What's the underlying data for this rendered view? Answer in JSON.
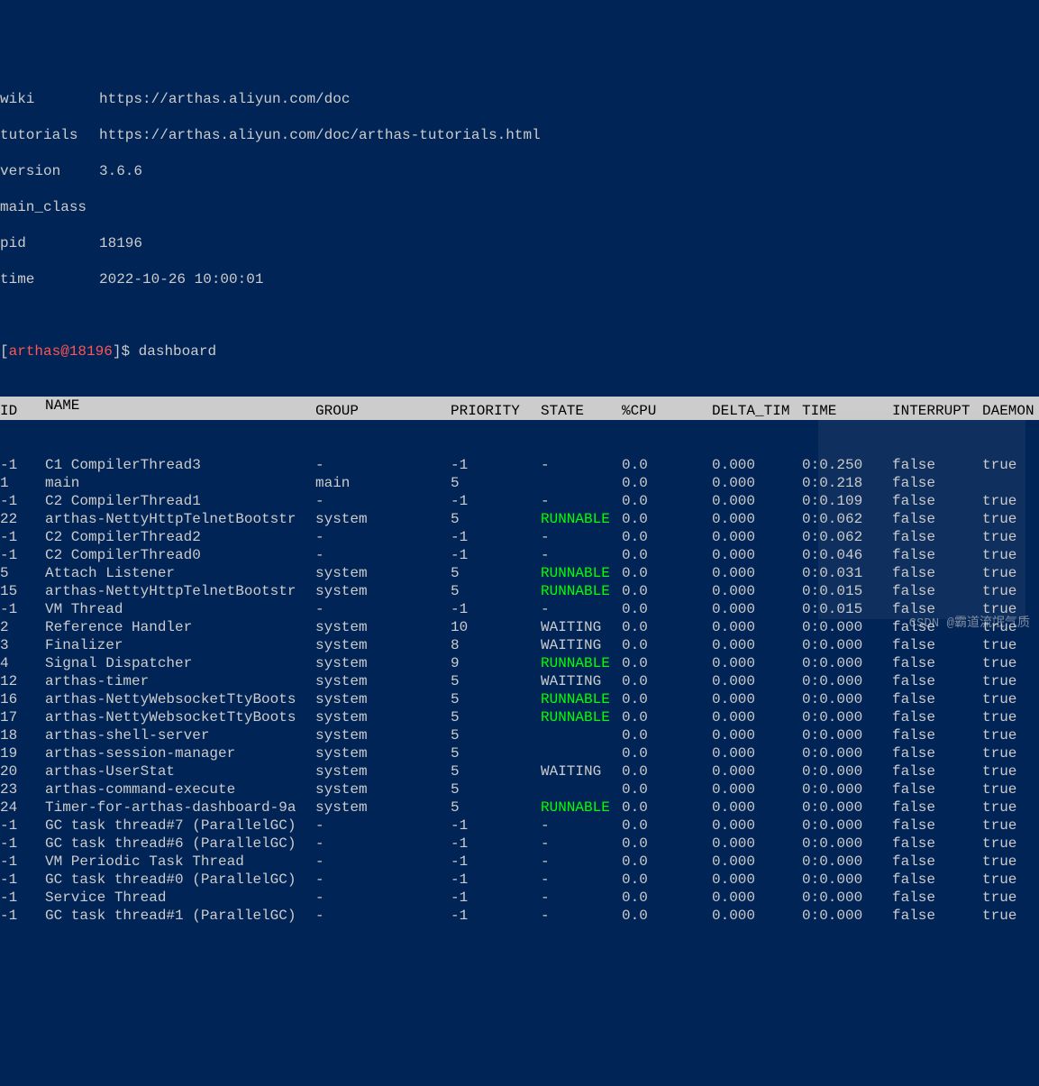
{
  "info": {
    "wiki_label": "wiki",
    "wiki_value": "https://arthas.aliyun.com/doc",
    "tutorials_label": "tutorials",
    "tutorials_value": "https://arthas.aliyun.com/doc/arthas-tutorials.html",
    "version_label": "version",
    "version_value": "3.6.6",
    "mainclass_label": "main_class",
    "mainclass_value": "",
    "pid_label": "pid",
    "pid_value": "18196",
    "time_label": "time",
    "time_value": "2022-10-26 10:00:01"
  },
  "prompt": {
    "open_bracket": "[",
    "text": "arthas@18196",
    "close_bracket": "]",
    "dollar": "$ ",
    "command": "dashboard"
  },
  "headers": {
    "id": "ID",
    "name": "NAME",
    "group": "GROUP",
    "priority": "PRIORITY",
    "state": "STATE",
    "cpu": "%CPU",
    "delta": "DELTA_TIM",
    "time": "TIME",
    "interrupt": "INTERRUPT",
    "daemon": "DAEMON"
  },
  "rows": [
    {
      "id": "-1",
      "name": "C1 CompilerThread3",
      "group": "-",
      "priority": "-1",
      "state": "-",
      "cpu": "0.0",
      "delta": "0.000",
      "time": "0:0.250",
      "interrupt": "false",
      "daemon": "true"
    },
    {
      "id": "1",
      "name": "main",
      "group": "main",
      "priority": "5",
      "state": "",
      "cpu": "0.0",
      "delta": "0.000",
      "time": "0:0.218",
      "interrupt": "false",
      "daemon": ""
    },
    {
      "id": "-1",
      "name": "C2 CompilerThread1",
      "group": "-",
      "priority": "-1",
      "state": "-",
      "cpu": "0.0",
      "delta": "0.000",
      "time": "0:0.109",
      "interrupt": "false",
      "daemon": "true"
    },
    {
      "id": "22",
      "name": "arthas-NettyHttpTelnetBootstr",
      "group": "system",
      "priority": "5",
      "state": "RUNNABLE",
      "cpu": "0.0",
      "delta": "0.000",
      "time": "0:0.062",
      "interrupt": "false",
      "daemon": "true"
    },
    {
      "id": "-1",
      "name": "C2 CompilerThread2",
      "group": "-",
      "priority": "-1",
      "state": "-",
      "cpu": "0.0",
      "delta": "0.000",
      "time": "0:0.062",
      "interrupt": "false",
      "daemon": "true"
    },
    {
      "id": "-1",
      "name": "C2 CompilerThread0",
      "group": "-",
      "priority": "-1",
      "state": "-",
      "cpu": "0.0",
      "delta": "0.000",
      "time": "0:0.046",
      "interrupt": "false",
      "daemon": "true"
    },
    {
      "id": "5",
      "name": "Attach Listener",
      "group": "system",
      "priority": "5",
      "state": "RUNNABLE",
      "cpu": "0.0",
      "delta": "0.000",
      "time": "0:0.031",
      "interrupt": "false",
      "daemon": "true"
    },
    {
      "id": "15",
      "name": "arthas-NettyHttpTelnetBootstr",
      "group": "system",
      "priority": "5",
      "state": "RUNNABLE",
      "cpu": "0.0",
      "delta": "0.000",
      "time": "0:0.015",
      "interrupt": "false",
      "daemon": "true"
    },
    {
      "id": "-1",
      "name": "VM Thread",
      "group": "-",
      "priority": "-1",
      "state": "-",
      "cpu": "0.0",
      "delta": "0.000",
      "time": "0:0.015",
      "interrupt": "false",
      "daemon": "true"
    },
    {
      "id": "2",
      "name": "Reference Handler",
      "group": "system",
      "priority": "10",
      "state": "WAITING",
      "cpu": "0.0",
      "delta": "0.000",
      "time": "0:0.000",
      "interrupt": "false",
      "daemon": "true"
    },
    {
      "id": "3",
      "name": "Finalizer",
      "group": "system",
      "priority": "8",
      "state": "WAITING",
      "cpu": "0.0",
      "delta": "0.000",
      "time": "0:0.000",
      "interrupt": "false",
      "daemon": "true"
    },
    {
      "id": "4",
      "name": "Signal Dispatcher",
      "group": "system",
      "priority": "9",
      "state": "RUNNABLE",
      "cpu": "0.0",
      "delta": "0.000",
      "time": "0:0.000",
      "interrupt": "false",
      "daemon": "true"
    },
    {
      "id": "12",
      "name": "arthas-timer",
      "group": "system",
      "priority": "5",
      "state": "WAITING",
      "cpu": "0.0",
      "delta": "0.000",
      "time": "0:0.000",
      "interrupt": "false",
      "daemon": "true"
    },
    {
      "id": "16",
      "name": "arthas-NettyWebsocketTtyBoots",
      "group": "system",
      "priority": "5",
      "state": "RUNNABLE",
      "cpu": "0.0",
      "delta": "0.000",
      "time": "0:0.000",
      "interrupt": "false",
      "daemon": "true"
    },
    {
      "id": "17",
      "name": "arthas-NettyWebsocketTtyBoots",
      "group": "system",
      "priority": "5",
      "state": "RUNNABLE",
      "cpu": "0.0",
      "delta": "0.000",
      "time": "0:0.000",
      "interrupt": "false",
      "daemon": "true"
    },
    {
      "id": "18",
      "name": "arthas-shell-server",
      "group": "system",
      "priority": "5",
      "state": "",
      "cpu": "0.0",
      "delta": "0.000",
      "time": "0:0.000",
      "interrupt": "false",
      "daemon": "true"
    },
    {
      "id": "19",
      "name": "arthas-session-manager",
      "group": "system",
      "priority": "5",
      "state": "",
      "cpu": "0.0",
      "delta": "0.000",
      "time": "0:0.000",
      "interrupt": "false",
      "daemon": "true"
    },
    {
      "id": "20",
      "name": "arthas-UserStat",
      "group": "system",
      "priority": "5",
      "state": "WAITING",
      "cpu": "0.0",
      "delta": "0.000",
      "time": "0:0.000",
      "interrupt": "false",
      "daemon": "true"
    },
    {
      "id": "23",
      "name": "arthas-command-execute",
      "group": "system",
      "priority": "5",
      "state": "",
      "cpu": "0.0",
      "delta": "0.000",
      "time": "0:0.000",
      "interrupt": "false",
      "daemon": "true"
    },
    {
      "id": "24",
      "name": "Timer-for-arthas-dashboard-9a",
      "group": "system",
      "priority": "5",
      "state": "RUNNABLE",
      "cpu": "0.0",
      "delta": "0.000",
      "time": "0:0.000",
      "interrupt": "false",
      "daemon": "true"
    },
    {
      "id": "-1",
      "name": "GC task thread#7 (ParallelGC)",
      "group": "-",
      "priority": "-1",
      "state": "-",
      "cpu": "0.0",
      "delta": "0.000",
      "time": "0:0.000",
      "interrupt": "false",
      "daemon": "true"
    },
    {
      "id": "-1",
      "name": "GC task thread#6 (ParallelGC)",
      "group": "-",
      "priority": "-1",
      "state": "-",
      "cpu": "0.0",
      "delta": "0.000",
      "time": "0:0.000",
      "interrupt": "false",
      "daemon": "true"
    },
    {
      "id": "-1",
      "name": "VM Periodic Task Thread",
      "group": "-",
      "priority": "-1",
      "state": "-",
      "cpu": "0.0",
      "delta": "0.000",
      "time": "0:0.000",
      "interrupt": "false",
      "daemon": "true"
    },
    {
      "id": "-1",
      "name": "GC task thread#0 (ParallelGC)",
      "group": "-",
      "priority": "-1",
      "state": "-",
      "cpu": "0.0",
      "delta": "0.000",
      "time": "0:0.000",
      "interrupt": "false",
      "daemon": "true"
    },
    {
      "id": "-1",
      "name": "Service Thread",
      "group": "-",
      "priority": "-1",
      "state": "-",
      "cpu": "0.0",
      "delta": "0.000",
      "time": "0:0.000",
      "interrupt": "false",
      "daemon": "true"
    },
    {
      "id": "-1",
      "name": "GC task thread#1 (ParallelGC)",
      "group": "-",
      "priority": "-1",
      "state": "-",
      "cpu": "0.0",
      "delta": "0.000",
      "time": "0:0.000",
      "interrupt": "false",
      "daemon": "true"
    }
  ],
  "watermark": "CSDN @霸道流氓气质"
}
